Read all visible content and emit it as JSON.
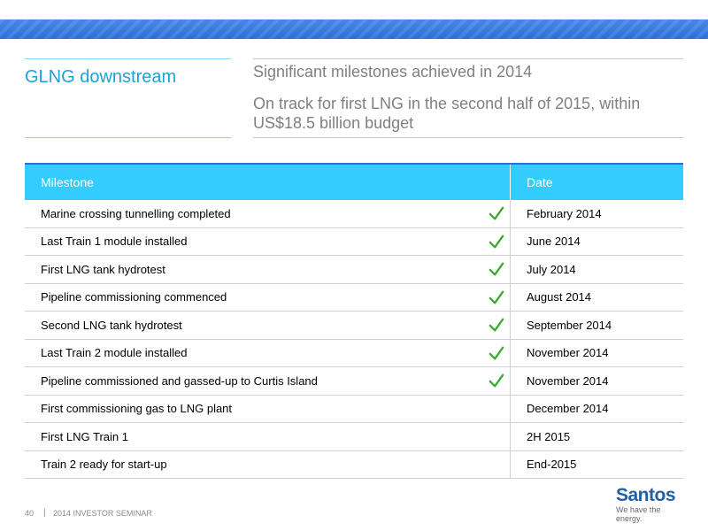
{
  "header": {
    "left_title": "GLNG downstream",
    "subtitle1": "Significant milestones achieved in 2014",
    "subtitle2": "On track for first LNG in the second half of 2015, within US$18.5 billion budget"
  },
  "table": {
    "col_milestone": "Milestone",
    "col_date": "Date",
    "rows": [
      {
        "milestone": "Marine crossing tunnelling completed",
        "checked": true,
        "date": "February 2014"
      },
      {
        "milestone": "Last Train 1 module installed",
        "checked": true,
        "date": "June 2014"
      },
      {
        "milestone": "First LNG tank hydrotest",
        "checked": true,
        "date": "July 2014"
      },
      {
        "milestone": "Pipeline commissioning commenced",
        "checked": true,
        "date": "August 2014"
      },
      {
        "milestone": "Second LNG tank hydrotest",
        "checked": true,
        "date": "September 2014"
      },
      {
        "milestone": "Last Train 2 module installed",
        "checked": true,
        "date": "November 2014"
      },
      {
        "milestone": "Pipeline commissioned and gassed-up to Curtis Island",
        "checked": true,
        "date": "November 2014"
      },
      {
        "milestone": "First commissioning gas to LNG plant",
        "checked": false,
        "date": "December 2014"
      },
      {
        "milestone": "First LNG Train 1",
        "checked": false,
        "date": "2H 2015"
      },
      {
        "milestone": "Train 2 ready for start-up",
        "checked": false,
        "date": "End-2015"
      }
    ]
  },
  "footer": {
    "page_number": "40",
    "separator": "|",
    "event": "2014 INVESTOR SEMINAR"
  },
  "logo": {
    "name": "Santos",
    "tagline": "We have the energy."
  },
  "colors": {
    "accent": "#33ccff",
    "title": "#1aa3d6",
    "check": "#3aaa35",
    "brand": "#1f5fa8"
  },
  "icons": {
    "check": "check-icon"
  }
}
